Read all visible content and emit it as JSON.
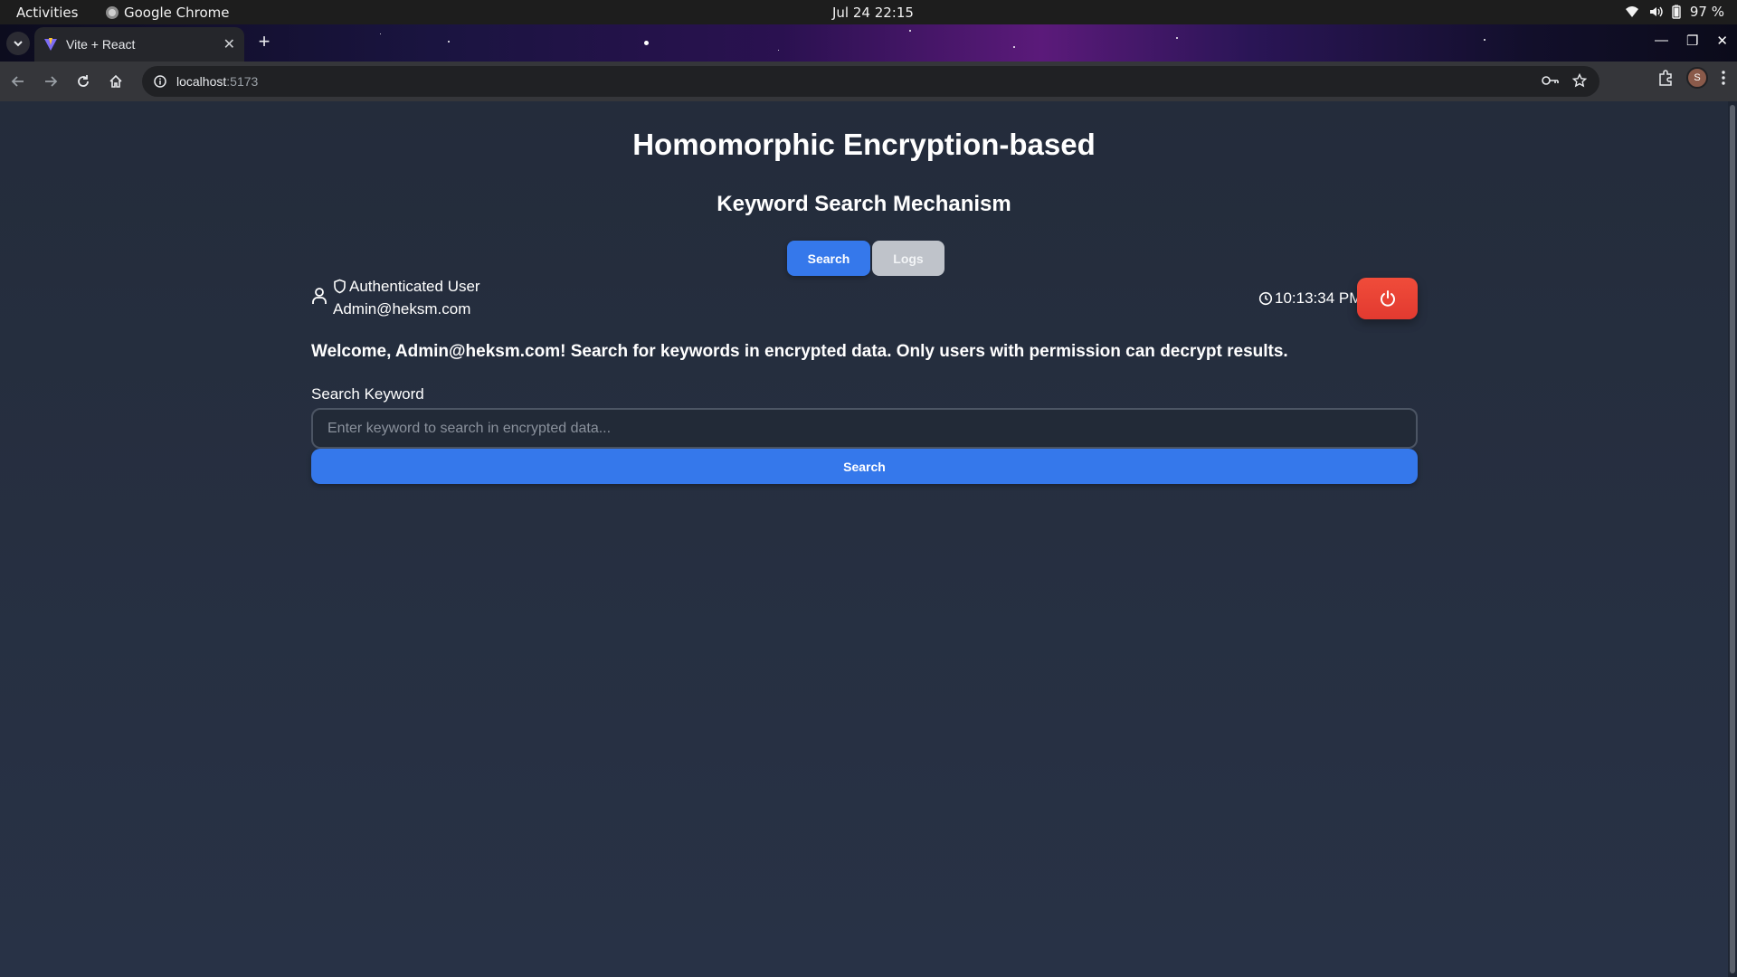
{
  "system_bar": {
    "activities": "Activities",
    "app_name": "Google Chrome",
    "datetime": "Jul 24  22:15",
    "battery": "97 %"
  },
  "browser": {
    "tab_title": "Vite + React",
    "url_host": "localhost",
    "url_port": ":5173"
  },
  "page": {
    "title": "Homomorphic Encryption-based",
    "subtitle": "Keyword Search Mechanism",
    "tabs": [
      {
        "label": "Search",
        "active": true
      },
      {
        "label": "Logs",
        "active": false
      }
    ],
    "user": {
      "role": "Authenticated User",
      "email": "Admin@heksm.com"
    },
    "clock": "10:13:34 PM",
    "welcome": "Welcome, Admin@heksm.com! Search for keywords in encrypted data. Only users with permission can decrypt results.",
    "search": {
      "label": "Search Keyword",
      "placeholder": "Enter keyword to search in encrypted data...",
      "value": "",
      "button": "Search"
    }
  },
  "colors": {
    "accent": "#3578eb",
    "logout": "#e23a30",
    "background": "#242c3b"
  }
}
